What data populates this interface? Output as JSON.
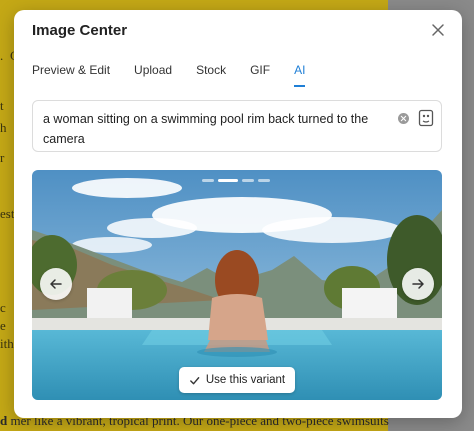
{
  "background": {
    "fragments": [
      ".",
      "C",
      "t",
      "h",
      "r",
      "est",
      "",
      "c",
      "e",
      "ith"
    ],
    "bottom_left": "d",
    "bottom_text": "mer like a vibrant, tropical print. Our one-piece and two-piece swimsuits"
  },
  "dialog": {
    "title": "Image Center",
    "close_label": "×",
    "tabs": [
      {
        "label": "Preview & Edit",
        "active": false
      },
      {
        "label": "Upload",
        "active": false
      },
      {
        "label": "Stock",
        "active": false
      },
      {
        "label": "GIF",
        "active": false
      },
      {
        "label": "AI",
        "active": true
      }
    ],
    "prompt": {
      "value": "a woman sitting on a swimming pool rim back turned to the camera"
    },
    "carousel": {
      "current_index": 2,
      "total": 4
    },
    "use_variant_label": "Use this variant"
  },
  "colors": {
    "accent": "#1f7fd6",
    "background_page": "#c4a816"
  }
}
